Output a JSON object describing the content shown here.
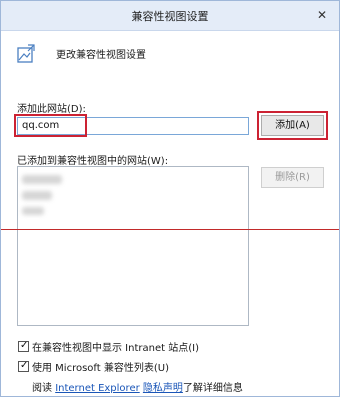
{
  "window": {
    "title": "兼容性视图设置",
    "close_glyph": "✕"
  },
  "header": {
    "text": "更改兼容性视图设置",
    "icon": "compatibility-view-icon"
  },
  "add_site": {
    "label": "添加此网站(D):",
    "value": "qq.com",
    "add_button": "添加(A)"
  },
  "site_list": {
    "label": "已添加到兼容性视图中的网站(W):",
    "remove_button": "删除(R)"
  },
  "options": {
    "intranet": {
      "label": "在兼容性视图中显示 Intranet 站点(I)",
      "checked": true
    },
    "ms_list": {
      "label": "使用 Microsoft 兼容性列表(U)",
      "checked": true
    }
  },
  "info": {
    "prefix": "阅读",
    "link1": "Internet Explorer",
    "link2": "隐私声明",
    "suffix": "了解详细信息"
  },
  "colors": {
    "highlight": "#cc2233",
    "link": "#1a56b8"
  }
}
